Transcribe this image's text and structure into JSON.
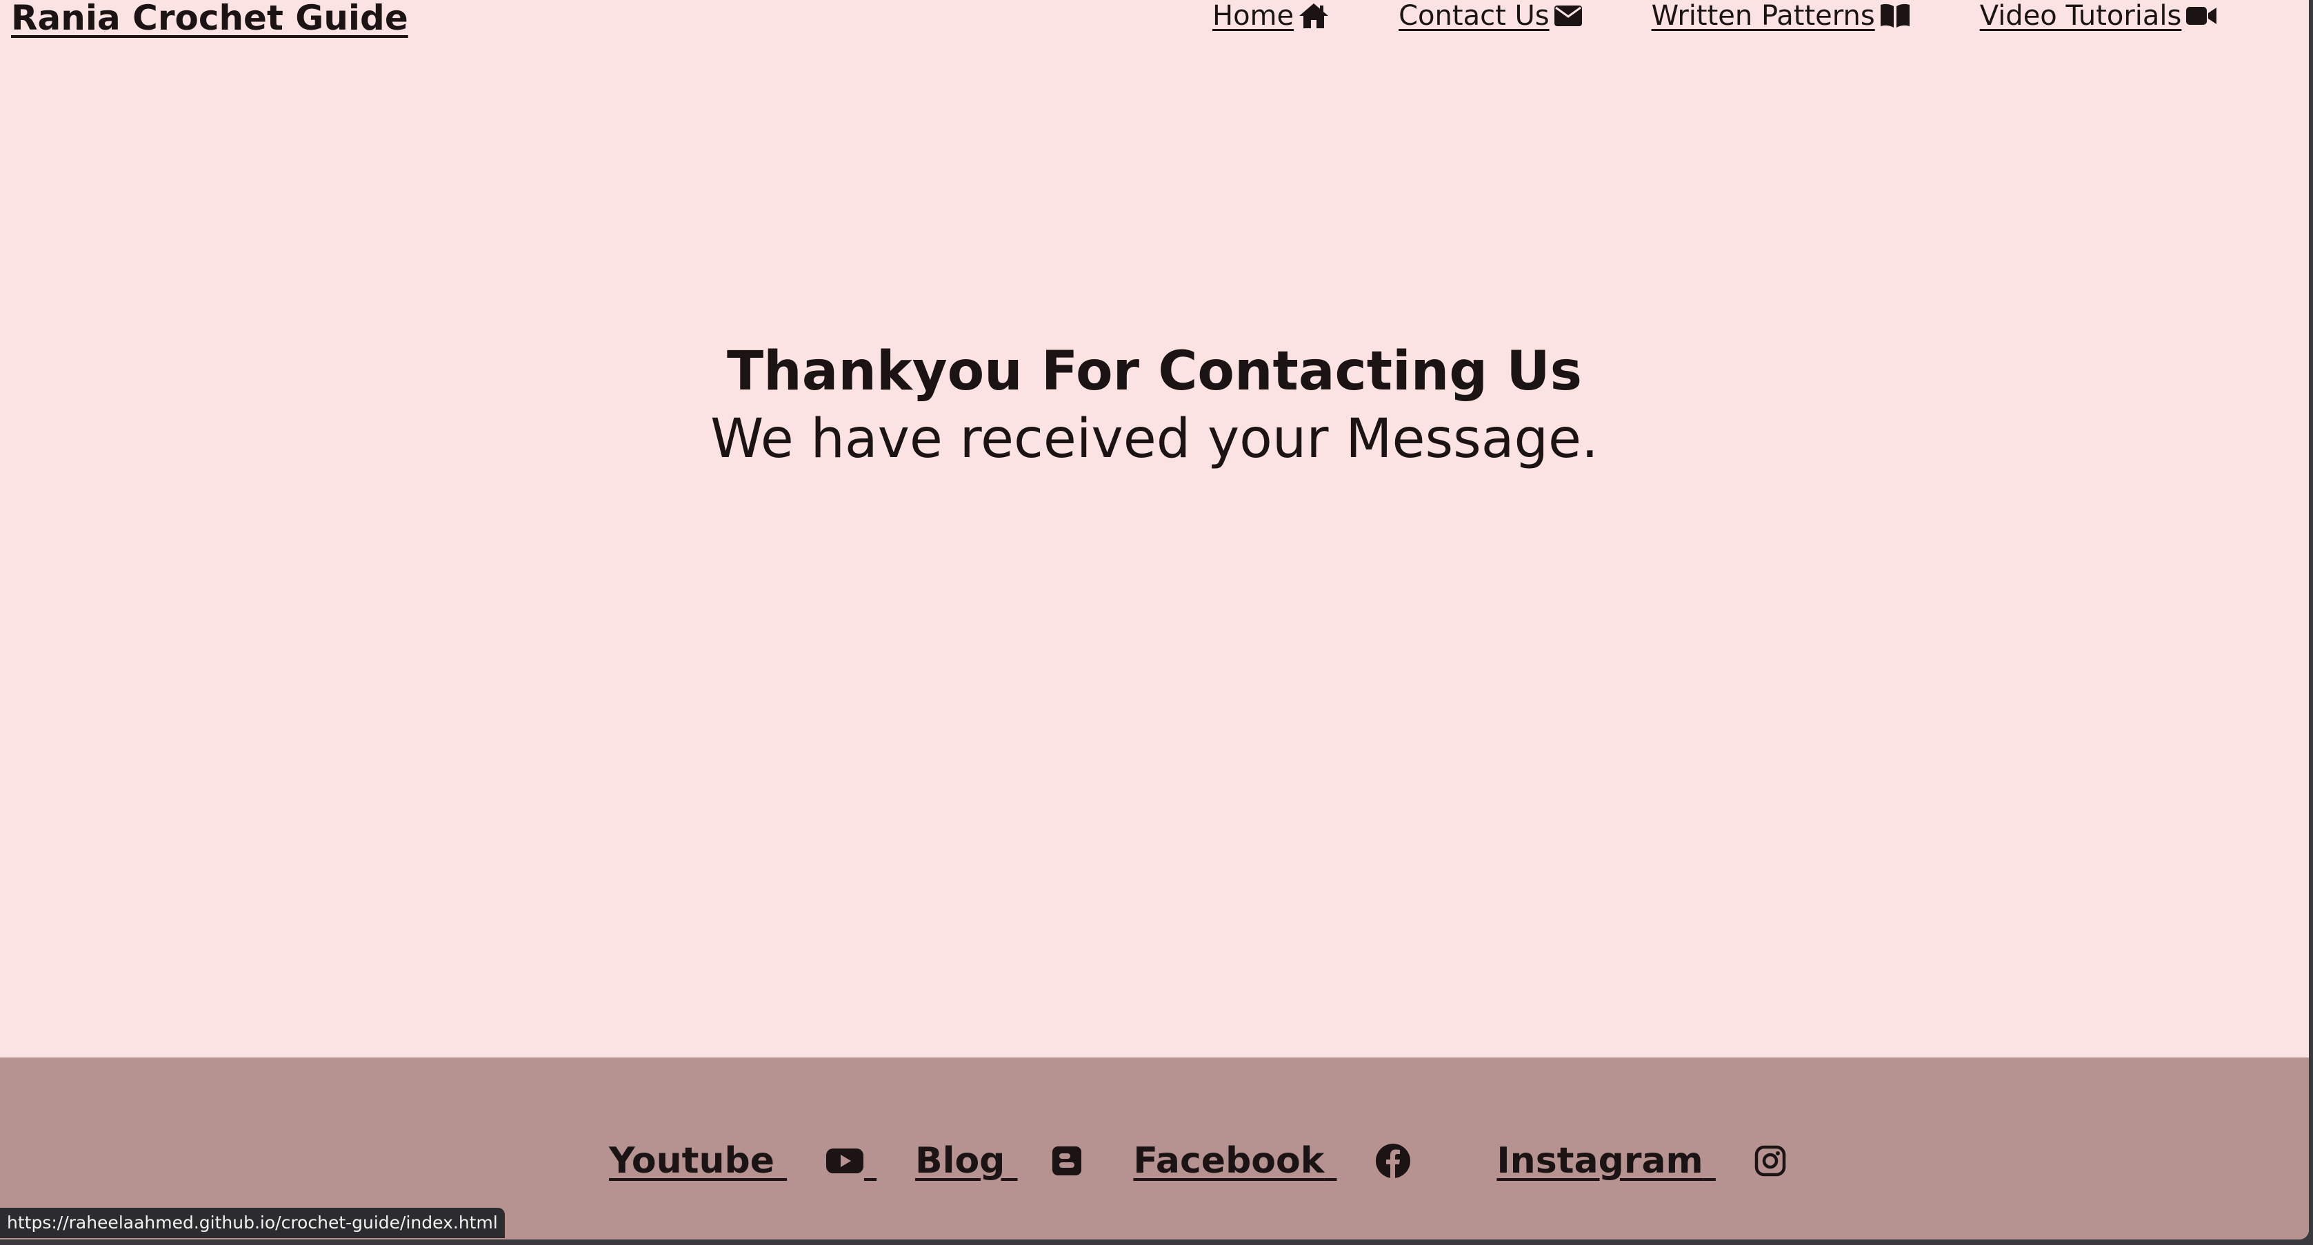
{
  "header": {
    "brand": "Rania Crochet Guide",
    "nav": [
      {
        "label": "Home",
        "icon": "home-icon"
      },
      {
        "label": "Contact Us",
        "icon": "envelope-icon"
      },
      {
        "label": "Written Patterns",
        "icon": "book-icon"
      },
      {
        "label": "Video Tutorials",
        "icon": "video-camera-icon"
      }
    ]
  },
  "main": {
    "heading": "Thankyou For Contacting Us",
    "message": "We have received your Message."
  },
  "footer": {
    "links": [
      {
        "label": "Youtube",
        "icon": "youtube-icon"
      },
      {
        "label": "Blog",
        "icon": "blogger-icon"
      },
      {
        "label": "Facebook",
        "icon": "facebook-icon"
      },
      {
        "label": "Instagram",
        "icon": "instagram-icon"
      }
    ]
  },
  "status_bar": {
    "url": "https://raheelaahmed.github.io/crochet-guide/index.html"
  },
  "colors": {
    "page_bg": "#fae3e2",
    "footer_bg": "#b69391",
    "text": "#1c1414"
  }
}
